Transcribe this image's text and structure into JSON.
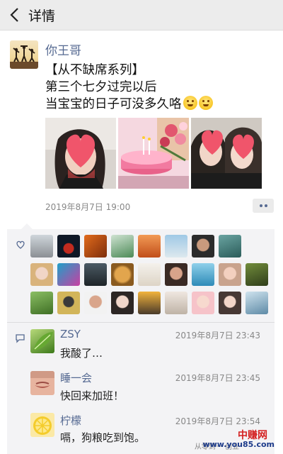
{
  "header": {
    "title": "详情",
    "back_icon": "chevron-left-icon"
  },
  "post": {
    "author": "你王哥",
    "lines": [
      "【从不缺席系列】",
      "第三个七夕过完以后",
      "当宝宝的日子可没多久咯"
    ],
    "emojis": [
      "smile-emoji",
      "smile-emoji"
    ],
    "photos": [
      "photo-girl-heart",
      "photo-cake-flowers",
      "photo-couple-hearts"
    ],
    "timestamp": "2019年8月7日 19:00",
    "more_icon": "more-dots-icon"
  },
  "likes": {
    "icon": "heart-outline-icon",
    "count": 24
  },
  "comments": [
    {
      "name": "ZSY",
      "time": "2019年8月7日 23:43",
      "text": "我酸了…",
      "avatar": "leaf-avatar"
    },
    {
      "name": "睡一会",
      "time": "2019年8月7日 23:45",
      "text": "快回来加班！",
      "avatar": "face-avatar"
    },
    {
      "name": "柠檬",
      "time": "2019年8月7日 23:54",
      "text": "嗝，狗粮吃到饱。",
      "avatar": "lemon-avatar"
    }
  ],
  "watermark": {
    "title": "中赚网",
    "url": "www.you85.com",
    "brand": "从零到一 创业"
  },
  "colors": {
    "link": "#566a92",
    "panel": "#f3f3f5",
    "heart": "#f0556b"
  }
}
